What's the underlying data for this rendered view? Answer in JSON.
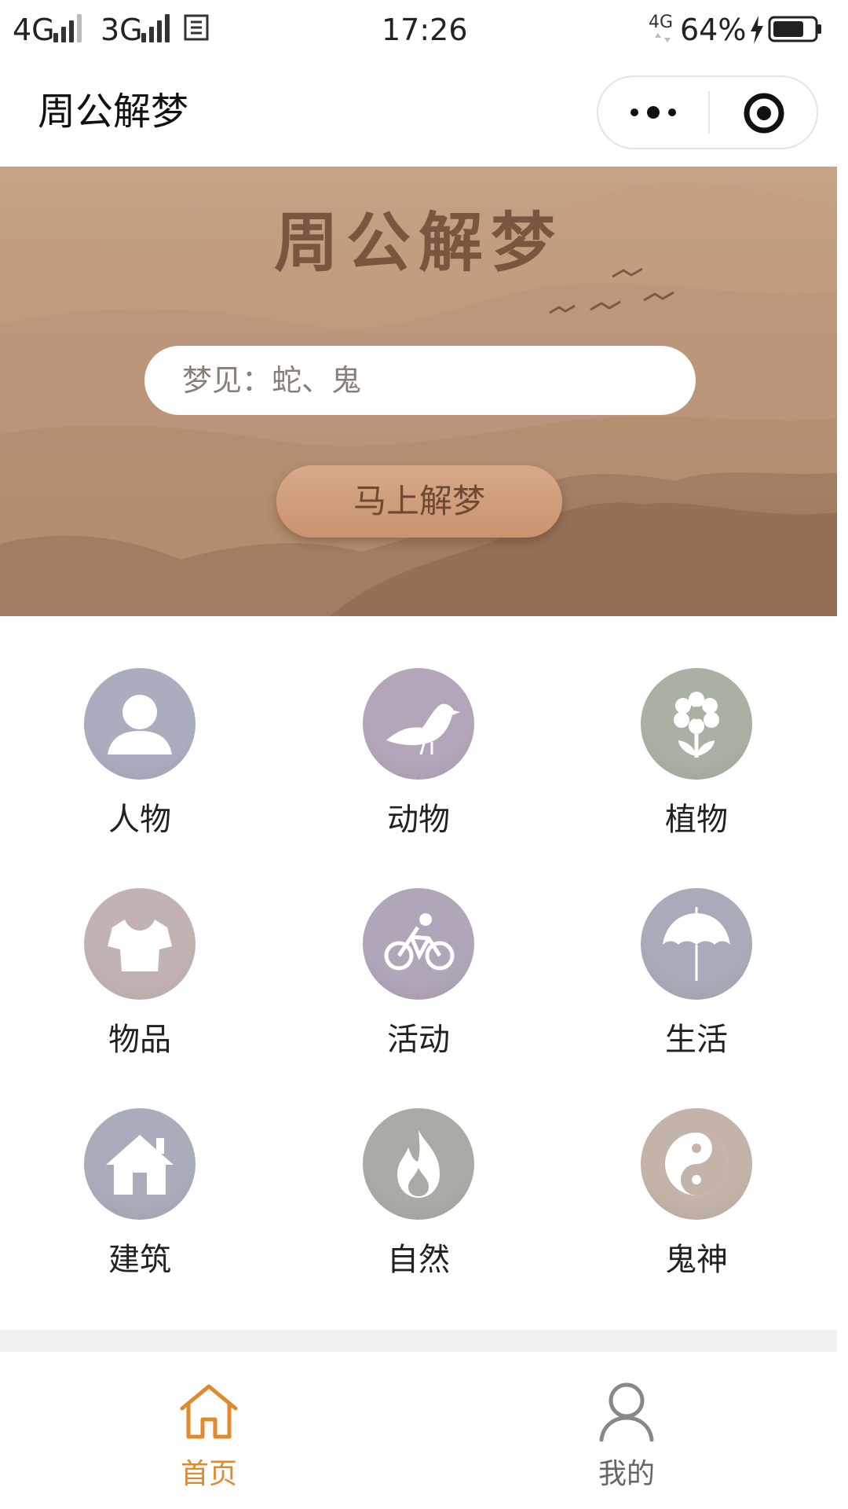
{
  "status_bar": {
    "network1": "4G",
    "network2": "3G",
    "time": "17:26",
    "network3": "4G",
    "battery": "64%"
  },
  "nav": {
    "title": "周公解梦",
    "more_icon": "more-dots-icon",
    "close_icon": "target-circle-icon"
  },
  "banner": {
    "title": "周公解梦",
    "search_placeholder": "梦见：蛇、鬼",
    "submit_label": "马上解梦"
  },
  "categories": [
    {
      "label": "人物",
      "icon": "person-icon",
      "color": "#a9adbd"
    },
    {
      "label": "动物",
      "icon": "bird-icon",
      "color": "#b3a6bb"
    },
    {
      "label": "植物",
      "icon": "flower-icon",
      "color": "#a9b0a4"
    },
    {
      "label": "物品",
      "icon": "tshirt-icon",
      "color": "#c3b2b2"
    },
    {
      "label": "活动",
      "icon": "bicycle-icon",
      "color": "#b0a5b9"
    },
    {
      "label": "生活",
      "icon": "umbrella-icon",
      "color": "#a9abba"
    },
    {
      "label": "建筑",
      "icon": "house-icon",
      "color": "#a9adbb"
    },
    {
      "label": "自然",
      "icon": "fire-icon",
      "color": "#a8aca4"
    },
    {
      "label": "鬼神",
      "icon": "yin-yang-icon",
      "color": "#c4b3a8"
    }
  ],
  "tabs": [
    {
      "label": "首页",
      "icon": "home-icon",
      "active": true
    },
    {
      "label": "我的",
      "icon": "user-icon",
      "active": false
    }
  ],
  "colors": {
    "accent": "#e08a2e",
    "inactive_tab": "#777777"
  }
}
